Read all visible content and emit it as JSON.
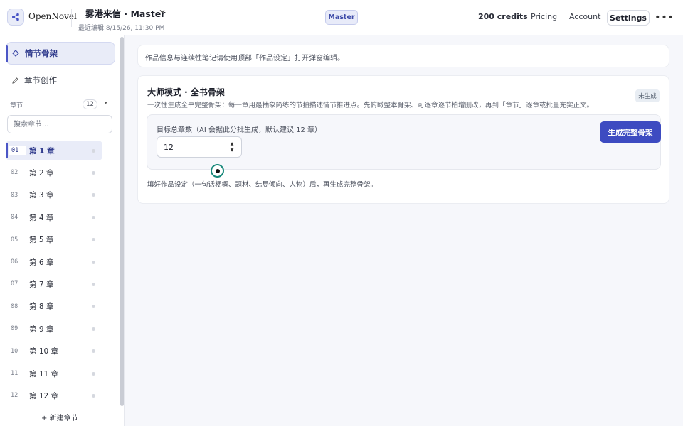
{
  "app": {
    "logo_text": "OpenNovel"
  },
  "header": {
    "project_title": "雾港来信 · Master",
    "last_edited": "最近编辑 8/15/26, 11:30 PM",
    "mode_badge": "Master",
    "credits": "200 credits",
    "links": [
      "Pricing",
      "Account"
    ],
    "settings_label": "Settings",
    "more_label": "•••"
  },
  "sidebar": {
    "nav": [
      {
        "label": "情节骨架",
        "icon": "diamond-icon",
        "active": true
      },
      {
        "label": "章节创作",
        "icon": "pencil-icon",
        "active": false
      }
    ],
    "section_label": "章节",
    "chapter_count": "12",
    "search_placeholder": "搜索章节...",
    "chapters": [
      {
        "num": "01",
        "name": "第 1 章"
      },
      {
        "num": "02",
        "name": "第 2 章"
      },
      {
        "num": "03",
        "name": "第 3 章"
      },
      {
        "num": "04",
        "name": "第 4 章"
      },
      {
        "num": "05",
        "name": "第 5 章"
      },
      {
        "num": "06",
        "name": "第 6 章"
      },
      {
        "num": "07",
        "name": "第 7 章"
      },
      {
        "num": "08",
        "name": "第 8 章"
      },
      {
        "num": "09",
        "name": "第 9 章"
      },
      {
        "num": "10",
        "name": "第 10 章"
      },
      {
        "num": "11",
        "name": "第 11 章"
      },
      {
        "num": "12",
        "name": "第 12 章"
      }
    ],
    "new_chapter_label": "+ 新建章节"
  },
  "main": {
    "info_note": "作品信息与连续性笔记请使用顶部「作品设定」打开弹窗编辑。",
    "master_card": {
      "title": "大师模式 · 全书骨架",
      "description": "一次性生成全书完整骨架：每一章用最抽象简练的节拍描述情节推进点。先俯瞰整本骨架、可逐章逐节拍增删改，再到「章节」逐章或批量充实正文。",
      "status": "未生成",
      "field_label": "目标总章数（AI 会据此分批生成，默认建议 12 章）",
      "chapter_total_value": "12",
      "generate_label": "生成完整骨架",
      "hint": "填好作品设定（一句话梗概、题材、结局倾向、人物）后，再生成完整骨架。"
    }
  },
  "colors": {
    "accent": "#3d4bc1",
    "accent_soft": "#e9ecf8",
    "cursor_ring": "#19897b"
  }
}
